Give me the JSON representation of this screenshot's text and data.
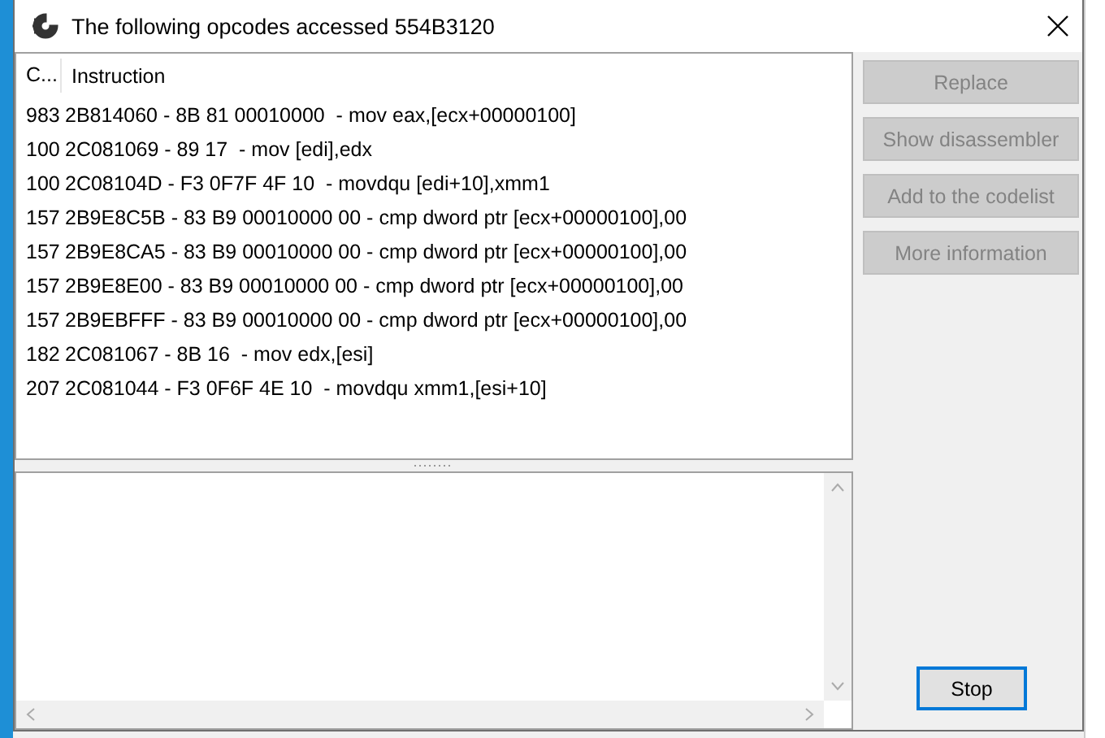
{
  "window": {
    "title": "The following opcodes accessed 554B3120"
  },
  "table": {
    "columns": [
      "C...",
      "Instruction"
    ],
    "rows": [
      {
        "count": "983",
        "instruction": "2B814060 - 8B 81 00010000  - mov eax,[ecx+00000100]"
      },
      {
        "count": "100",
        "instruction": "2C081069 - 89 17  - mov [edi],edx"
      },
      {
        "count": "100",
        "instruction": "2C08104D - F3 0F7F 4F 10  - movdqu [edi+10],xmm1"
      },
      {
        "count": "157",
        "instruction": "2B9E8C5B - 83 B9 00010000 00 - cmp dword ptr [ecx+00000100],00"
      },
      {
        "count": "157",
        "instruction": "2B9E8CA5 - 83 B9 00010000 00 - cmp dword ptr [ecx+00000100],00"
      },
      {
        "count": "157",
        "instruction": "2B9E8E00 - 83 B9 00010000 00 - cmp dword ptr [ecx+00000100],00"
      },
      {
        "count": "157",
        "instruction": "2B9EBFFF - 83 B9 00010000 00 - cmp dword ptr [ecx+00000100],00"
      },
      {
        "count": "182",
        "instruction": "2C081067 - 8B 16  - mov edx,[esi]"
      },
      {
        "count": "207",
        "instruction": "2C081044 - F3 0F6F 4E 10  - movdqu xmm1,[esi+10]"
      }
    ]
  },
  "buttons": [
    {
      "label": "Replace",
      "disabled": true
    },
    {
      "label": "Show disassembler",
      "disabled": true
    },
    {
      "label": "Add to the codelist",
      "disabled": true
    },
    {
      "label": "More information",
      "disabled": true
    }
  ],
  "stop_button": {
    "label": "Stop",
    "focused": true
  }
}
